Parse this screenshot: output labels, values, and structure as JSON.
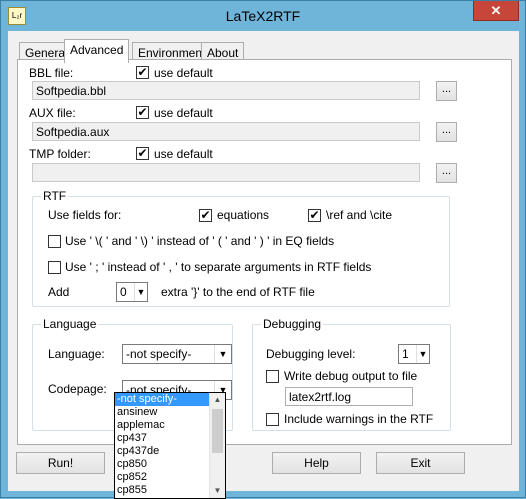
{
  "window": {
    "title": "LaTeX2RTF",
    "icon_text": "L₂r",
    "close": "✕"
  },
  "tabs": [
    {
      "label": "General"
    },
    {
      "label": "Advanced"
    },
    {
      "label": "Environment"
    },
    {
      "label": "About"
    }
  ],
  "files": {
    "bbl": {
      "label": "BBL file:",
      "use_default": "use default",
      "value": "Softpedia.bbl"
    },
    "aux": {
      "label": "AUX file:",
      "use_default": "use default",
      "value": "Softpedia.aux"
    },
    "tmp": {
      "label": "TMP folder:",
      "use_default": "use default",
      "value": ""
    },
    "browse_label": "..."
  },
  "rtf": {
    "title": "RTF",
    "use_fields_label": "Use fields for:",
    "equations_label": "equations",
    "ref_cite_label": "\\ref and \\cite",
    "eq_delims_label": "Use ' \\( ' and ' \\) ' instead of ' ( ' and ' ) ' in EQ fields",
    "semicolon_label": "Use ' ; ' instead of ' , ' to separate arguments in RTF fields",
    "add_label": "Add",
    "add_value": "0",
    "extra_label": "extra '}' to the end of RTF file"
  },
  "language": {
    "title": "Language",
    "language_label": "Language:",
    "language_value": "-not specify-",
    "codepage_label": "Codepage:",
    "codepage_value": "-not specify-",
    "codepage_options": [
      "-not specify-",
      "ansinew",
      "applemac",
      "cp437",
      "cp437de",
      "cp850",
      "cp852",
      "cp855"
    ]
  },
  "debugging": {
    "title": "Debugging",
    "level_label": "Debugging level:",
    "level_value": "1",
    "write_output_label": "Write debug output to file",
    "output_file": "latex2rtf.log",
    "include_warnings_label": "Include warnings in the RTF"
  },
  "buttons": {
    "run": "Run!",
    "help": "Help",
    "exit": "Exit"
  },
  "check_mark": "✔",
  "arrow_down": "▼",
  "arrow_up": "▲"
}
